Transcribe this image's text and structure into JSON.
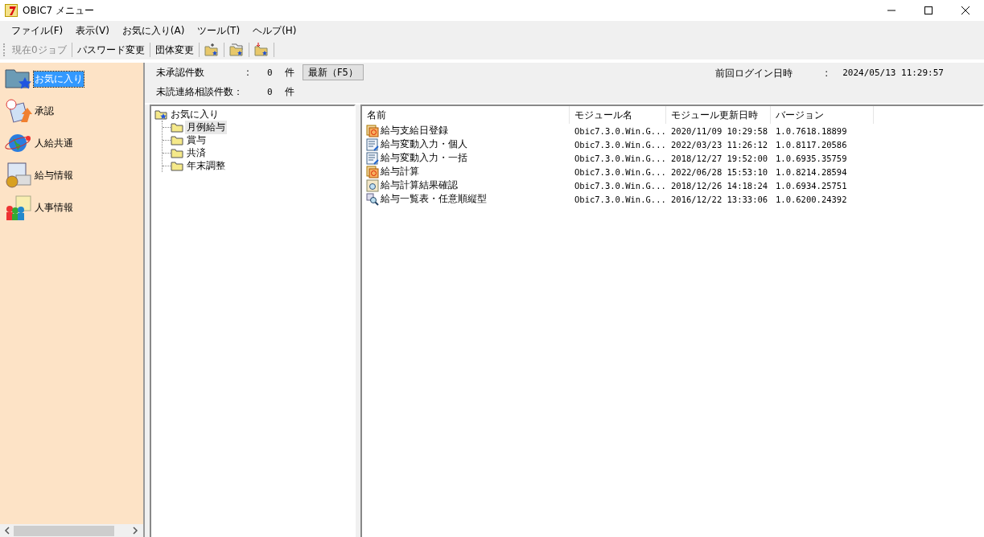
{
  "window": {
    "title": "OBIC7 メニュー"
  },
  "menu": [
    "ファイル(F)",
    "表示(V)",
    "お気に入り(A)",
    "ツール(T)",
    "ヘルプ(H)"
  ],
  "toolbar": [
    {
      "kind": "text",
      "label": "現在0ジョブ",
      "disabled": true
    },
    {
      "kind": "text",
      "label": "パスワード変更",
      "disabled": false
    },
    {
      "kind": "text",
      "label": "団体変更",
      "disabled": false
    },
    {
      "kind": "add"
    },
    {
      "kind": "copy"
    },
    {
      "kind": "move"
    }
  ],
  "sidebar": {
    "items": [
      {
        "kind": "favorites",
        "label": "お気に入り",
        "selected": true
      },
      {
        "kind": "approval",
        "label": "承認",
        "selected": false
      },
      {
        "kind": "globe",
        "label": "人給共通",
        "selected": false
      },
      {
        "kind": "payroll",
        "label": "給与情報",
        "selected": false
      },
      {
        "kind": "personnel",
        "label": "人事情報",
        "selected": false
      }
    ]
  },
  "info": {
    "pending_label": "未承認件数",
    "pending_colon": ":",
    "pending_count": "0",
    "pending_unit": "件",
    "unread_label": "未読連絡相談件数：",
    "unread_count": "0",
    "unread_unit": "件",
    "refresh_button": "最新（F5）",
    "last_login_label": "前回ログイン日時",
    "last_login_colon": ":",
    "last_login_value": "2024/05/13 11:29:57"
  },
  "tree": {
    "label": "お気に入り",
    "children": [
      {
        "label": "月例給与",
        "selected": true
      },
      {
        "label": "賞与",
        "selected": false
      },
      {
        "label": "共済",
        "selected": false
      },
      {
        "label": "年末調整",
        "selected": false
      }
    ]
  },
  "table": {
    "columns": [
      "名前",
      "モジュール名",
      "モジュール更新日時",
      "バージョン"
    ],
    "rows": [
      {
        "kind": "process",
        "name": "給与支給日登録",
        "module": "Obic7.3.0.Win.G...",
        "updated": "2020/11/09 10:29:58",
        "version": "1.0.7618.18899"
      },
      {
        "kind": "input",
        "name": "給与変動入力・個人",
        "module": "Obic7.3.0.Win.G...",
        "updated": "2022/03/23 11:26:12",
        "version": "1.0.8117.20586"
      },
      {
        "kind": "input",
        "name": "給与変動入力・一括",
        "module": "Obic7.3.0.Win.G...",
        "updated": "2018/12/27 19:52:00",
        "version": "1.0.6935.35759"
      },
      {
        "kind": "process",
        "name": "給与計算",
        "module": "Obic7.3.0.Win.G...",
        "updated": "2022/06/28 15:53:10",
        "version": "1.0.8214.28594"
      },
      {
        "kind": "check",
        "name": "給与計算結果確認",
        "module": "Obic7.3.0.Win.G...",
        "updated": "2018/12/26 14:18:24",
        "version": "1.0.6934.25751"
      },
      {
        "kind": "report",
        "name": "給与一覧表・任意順縦型",
        "module": "Obic7.3.0.Win.G...",
        "updated": "2016/12/22 13:33:06",
        "version": "1.0.6200.24392"
      }
    ]
  }
}
